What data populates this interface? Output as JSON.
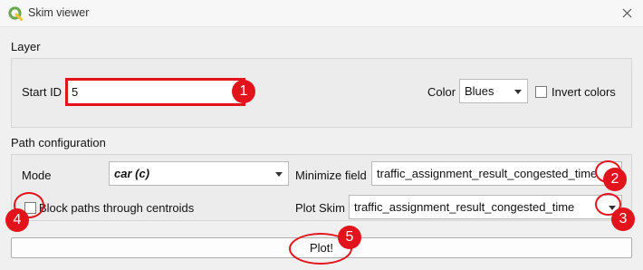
{
  "window": {
    "title": "Skim viewer",
    "logo_icon": "qgis-logo-icon",
    "close_icon": "close-icon"
  },
  "layer": {
    "section_label": "Layer",
    "start_id_label": "Start ID",
    "start_id_value": "5",
    "color_label": "Color",
    "color_value": "Blues",
    "invert_label": "Invert colors",
    "invert_checked": false
  },
  "path_config": {
    "section_label": "Path configuration",
    "mode_label": "Mode",
    "mode_value": "car (c)",
    "minimize_label": "Minimize field",
    "minimize_value": "traffic_assignment_result_congested_time",
    "block_label": "Block paths through centroids",
    "block_checked": false,
    "plot_skim_label": "Plot Skim",
    "plot_skim_value": "traffic_assignment_result_congested_time"
  },
  "plot_button_label": "Plot!",
  "annotations": [
    "1",
    "2",
    "3",
    "4",
    "5"
  ],
  "colors": {
    "annotation": "#e3131b",
    "qgis_green": "#6aa84f",
    "qgis_yellow": "#f1c232"
  }
}
